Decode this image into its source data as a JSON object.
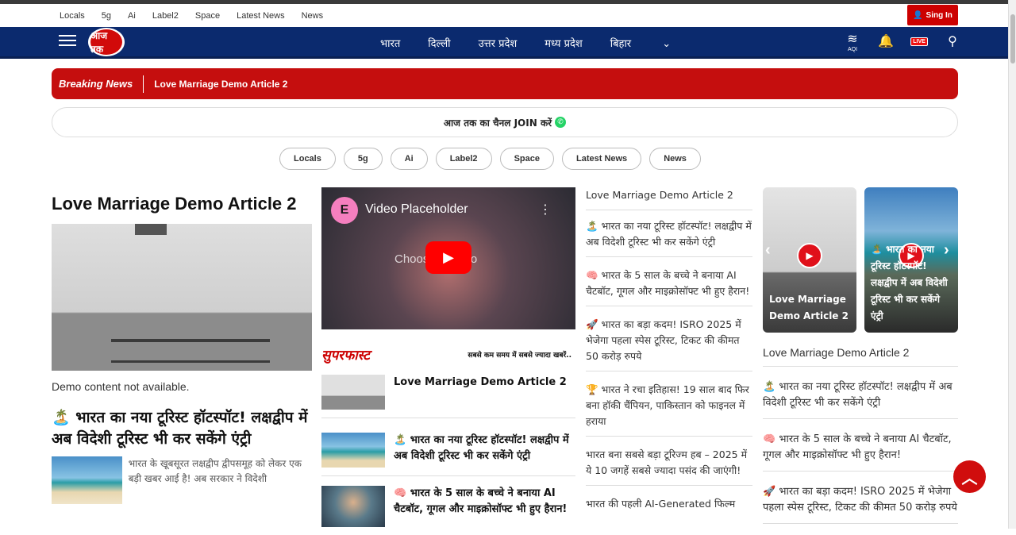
{
  "topbar": {
    "links": [
      "Locals",
      "5g",
      "Ai",
      "Label2",
      "Space",
      "Latest News",
      "News"
    ],
    "signin": "Sing In"
  },
  "navbar": {
    "logo": "आज तक",
    "menu": [
      "भारत",
      "दिल्ली",
      "उत्तर प्रदेश",
      "मध्य प्रदेश",
      "बिहार"
    ],
    "aqi": "AQI",
    "live": "LIVE"
  },
  "breaking": {
    "label": "Breaking News",
    "text": "Love Marriage Demo Article 2"
  },
  "join": "आज तक का चैनल JOIN करें",
  "chips": [
    "Locals",
    "5g",
    "Ai",
    "Label2",
    "Space",
    "Latest News",
    "News"
  ],
  "col1": {
    "title": "Love Marriage Demo Article 2",
    "demo": "Demo content not available.",
    "story_title": "🏝️ भारत का नया टूरिस्ट हॉटस्पॉट! लक्षद्वीप में अब विदेशी टूरिस्ट भी कर सकेंगे एंट्री",
    "story_text": "भारत के खूबसूरत लक्षद्वीप द्वीपसमूह को लेकर एक बड़ी खबर आई है! अब सरकार ने विदेशी"
  },
  "col2": {
    "video_title": "Video Placeholder",
    "video_choose": "Choose a video",
    "video_logo": "E",
    "brand": "सुपरफास्ट",
    "tagline": "सबसे कम समय में सबसे ज्यादा खबरें..",
    "rows": [
      "Love Marriage Demo Article 2",
      "🏝️ भारत का नया टूरिस्ट हॉटस्पॉट! लक्षद्वीप में अब विदेशी टूरिस्ट भी कर सकेंगे एंट्री",
      "🧠 भारत के 5 साल के बच्चे ने बनाया AI चैटबॉट, गूगल और माइक्रोसॉफ्ट भी हुए हैरान!"
    ]
  },
  "col3": {
    "items": [
      "Love Marriage Demo Article 2",
      "🏝️ भारत का नया टूरिस्ट हॉटस्पॉट! लक्षद्वीप में अब विदेशी टूरिस्ट भी कर सकेंगे एंट्री",
      "🧠 भारत के 5 साल के बच्चे ने बनाया AI चैटबॉट, गूगल और माइक्रोसॉफ्ट भी हुए हैरान!",
      "🚀 भारत का बड़ा कदम! ISRO 2025 में भेजेगा पहला स्पेस टूरिस्ट, टिकट की कीमत 50 करोड़ रुपये",
      "🏆 भारत ने रचा इतिहास! 19 साल बाद फिर बना हॉकी चैंपियन, पाकिस्तान को फाइनल में हराया",
      "भारत बना सबसे बड़ा टूरिज्म हब – 2025 में ये 10 जगहें सबसे ज्यादा पसंद की जाएंगी!",
      "भारत की पहली AI-Generated फिल्म"
    ]
  },
  "col4": {
    "cards": [
      "Love Marriage Demo Article 2",
      "🏝️ भारत का नया टूरिस्ट हॉटस्पॉट! लक्षद्वीप में अब विदेशी टूरिस्ट भी कर सकेंगे एंट्री"
    ],
    "head": "Love Marriage Demo Article 2",
    "items": [
      "🏝️ भारत का नया टूरिस्ट हॉटस्पॉट! लक्षद्वीप में अब विदेशी टूरिस्ट भी कर सकेंगे एंट्री",
      "🧠 भारत के 5 साल के बच्चे ने बनाया AI चैटबॉट, गूगल और माइक्रोसॉफ्ट भी हुए हैरान!",
      "🚀 भारत का बड़ा कदम! ISRO 2025 में भेजेगा पहला स्पेस टूरिस्ट, टिकट की कीमत 50 करोड़ रुपये"
    ]
  },
  "icons": {
    "menu": "hamburger-icon",
    "user": "user-icon",
    "bell": "bell-icon",
    "search": "search-icon",
    "live": "live-tv-icon",
    "aqi": "aqi-icon",
    "whatsapp": "whatsapp-icon",
    "top": "chevron-up-icon"
  },
  "colors": {
    "brand_red": "#c50e0e",
    "nav_blue": "#0b2a6e"
  }
}
